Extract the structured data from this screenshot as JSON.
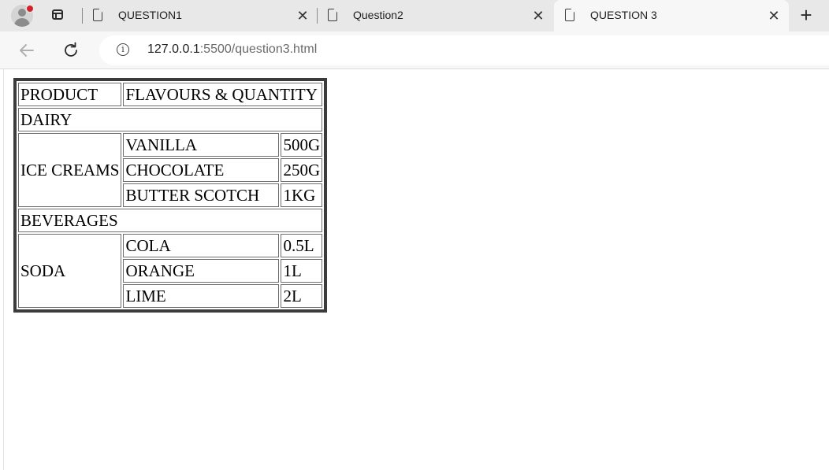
{
  "browser": {
    "tabs": [
      {
        "title": "QUESTION1",
        "close_icon": "close-icon"
      },
      {
        "title": "Question2",
        "close_icon": "close-icon"
      },
      {
        "title": "QUESTION 3",
        "close_icon": "close-icon",
        "active": true
      }
    ],
    "new_tab_label": "+",
    "close_glyph": "✕",
    "address": {
      "host": "127.0.0.1",
      "rest": ":5500/question3.html",
      "info_glyph": "i"
    },
    "notification_color": "#d2232a"
  },
  "table": {
    "header": [
      "PRODUCT",
      "FLAVOURS & QUANTITY"
    ],
    "categories": [
      {
        "name": "DAIRY",
        "product": "ICE CREAMS",
        "items": [
          {
            "flavour": "VANILLA",
            "quantity": "500G"
          },
          {
            "flavour": "CHOCOLATE",
            "quantity": "250G"
          },
          {
            "flavour": "BUTTER SCOTCH",
            "quantity": "1KG"
          }
        ]
      },
      {
        "name": "BEVERAGES",
        "product": "SODA",
        "items": [
          {
            "flavour": "COLA",
            "quantity": "0.5L"
          },
          {
            "flavour": "ORANGE",
            "quantity": "1L"
          },
          {
            "flavour": "LIME",
            "quantity": "2L"
          }
        ]
      }
    ]
  }
}
